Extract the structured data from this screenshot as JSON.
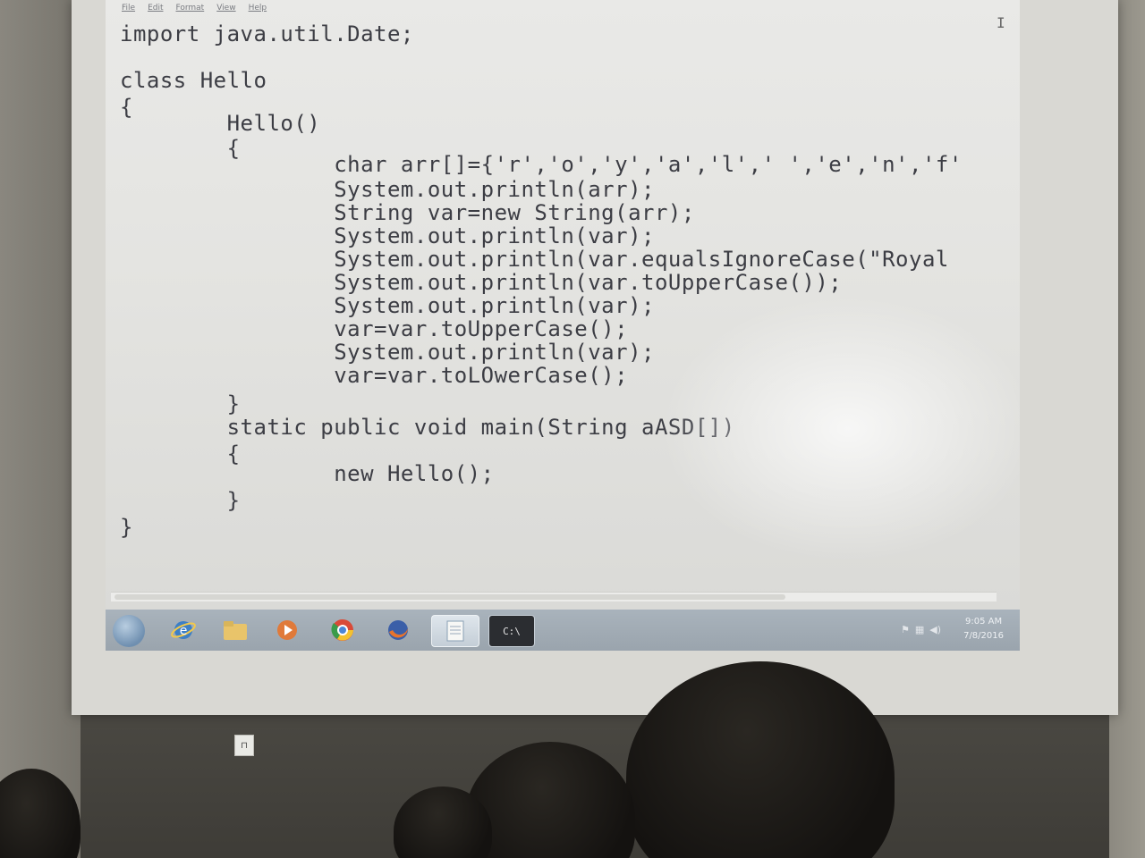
{
  "menubar": {
    "items": [
      "File",
      "Edit",
      "Format",
      "View",
      "Help"
    ]
  },
  "editor": {
    "language": "Java",
    "lines": [
      "import java.util.Date;",
      "",
      "class Hello",
      "{",
      "        Hello()",
      "        {",
      "                char arr[]={'r','o','y','a','l',' ','e','n','f'",
      "                System.out.println(arr);",
      "                String var=new String(arr);",
      "                System.out.println(var);",
      "                System.out.println(var.equalsIgnoreCase(\"Royal",
      "                System.out.println(var.toUpperCase());",
      "                System.out.println(var);",
      "                var=var.toUpperCase();",
      "                System.out.println(var);",
      "                var=var.toLOwerCase();",
      "        }",
      "        static public void main(String aASD[])",
      "        {",
      "                new Hello();",
      "        }",
      "}"
    ]
  },
  "taskbar": {
    "items": [
      {
        "name": "start-button",
        "icon": "windows-orb-icon"
      },
      {
        "name": "ie",
        "icon": "internet-explorer-icon"
      },
      {
        "name": "explorer",
        "icon": "folder-icon"
      },
      {
        "name": "media",
        "icon": "media-player-icon"
      },
      {
        "name": "chrome",
        "icon": "chrome-icon"
      },
      {
        "name": "firefox",
        "icon": "firefox-icon"
      },
      {
        "name": "notepad",
        "icon": "notepad-icon"
      },
      {
        "name": "cmd",
        "icon": "command-prompt-icon"
      }
    ],
    "clock_time": "9:05 AM",
    "clock_date": "7/8/2016"
  },
  "colors": {
    "code_text": "#3c3d44",
    "projection_bg": "#e6e6e3",
    "taskbar_bg": "#a3adb6"
  }
}
